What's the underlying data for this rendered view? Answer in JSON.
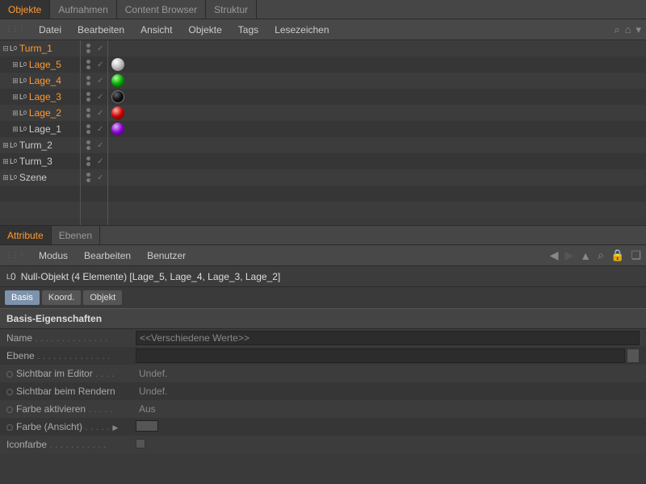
{
  "topTabs": [
    "Objekte",
    "Aufnahmen",
    "Content Browser",
    "Struktur"
  ],
  "topTabActive": 0,
  "menubar": [
    "Datei",
    "Bearbeiten",
    "Ansicht",
    "Objekte",
    "Tags",
    "Lesezeichen"
  ],
  "tree": [
    {
      "name": "Turm_1",
      "selected": true,
      "expanded": true,
      "indent": 0,
      "sphere": null
    },
    {
      "name": "Lage_5",
      "selected": true,
      "expanded": false,
      "indent": 1,
      "sphere": "white"
    },
    {
      "name": "Lage_4",
      "selected": true,
      "expanded": false,
      "indent": 1,
      "sphere": "green"
    },
    {
      "name": "Lage_3",
      "selected": true,
      "expanded": false,
      "indent": 1,
      "sphere": "black"
    },
    {
      "name": "Lage_2",
      "selected": true,
      "expanded": false,
      "indent": 1,
      "sphere": "red"
    },
    {
      "name": "Lage_1",
      "selected": false,
      "expanded": false,
      "indent": 1,
      "sphere": "purple"
    },
    {
      "name": "Turm_2",
      "selected": false,
      "expanded": false,
      "indent": 0,
      "sphere": null
    },
    {
      "name": "Turm_3",
      "selected": false,
      "expanded": false,
      "indent": 0,
      "sphere": null
    },
    {
      "name": "Szene",
      "selected": false,
      "expanded": false,
      "indent": 0,
      "sphere": null
    }
  ],
  "attrTabs": [
    "Attribute",
    "Ebenen"
  ],
  "attrTabActive": 0,
  "attrMenubar": [
    "Modus",
    "Bearbeiten",
    "Benutzer"
  ],
  "objectHeader": "Null-Objekt (4 Elemente) [Lage_5, Lage_4, Lage_3, Lage_2]",
  "subTabs": [
    "Basis",
    "Koord.",
    "Objekt"
  ],
  "subTabActive": 0,
  "sectionTitle": "Basis-Eigenschaften",
  "props": {
    "name_label": "Name",
    "name_value": "<<Verschiedene Werte>>",
    "ebene_label": "Ebene",
    "ebene_value": "",
    "vis_editor_label": "Sichtbar im Editor",
    "vis_editor_value": "Undef.",
    "vis_render_label": "Sichtbar beim Rendern",
    "vis_render_value": "Undef.",
    "color_enable_label": "Farbe aktivieren",
    "color_enable_value": "Aus",
    "color_view_label": "Farbe (Ansicht)",
    "iconcolor_label": "Iconfarbe"
  }
}
